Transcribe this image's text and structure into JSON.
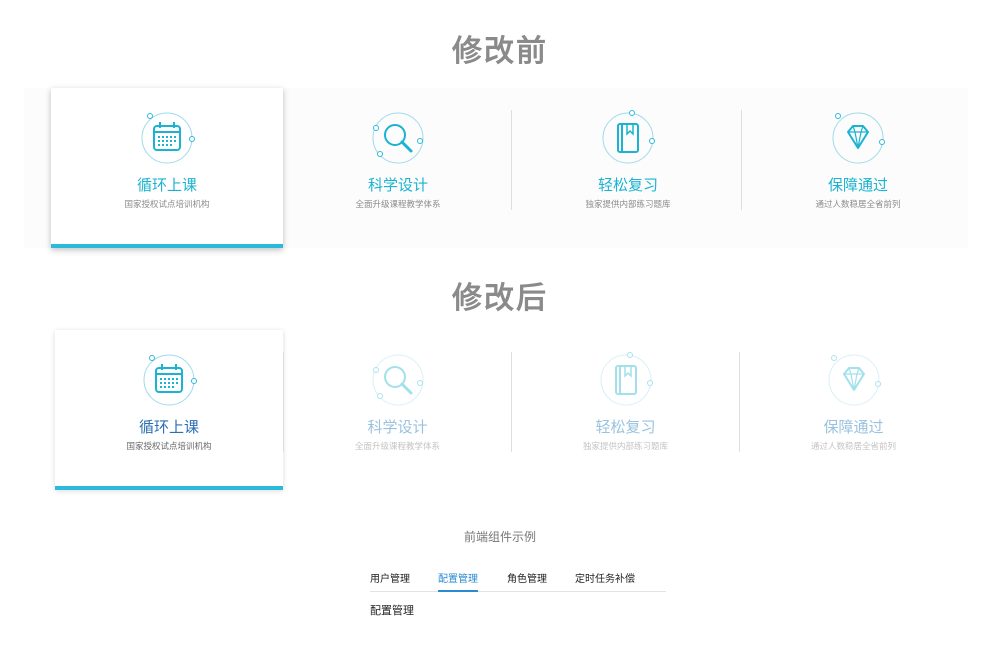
{
  "before": {
    "title": "修改前",
    "cards": [
      {
        "title": "循环上课",
        "sub": "国家授权试点培训机构",
        "icon": "calendar-icon"
      },
      {
        "title": "科学设计",
        "sub": "全面升级课程教学体系",
        "icon": "magnifier-icon"
      },
      {
        "title": "轻松复习",
        "sub": "独家提供内部练习题库",
        "icon": "book-icon"
      },
      {
        "title": "保障通过",
        "sub": "通过人数稳居全省前列",
        "icon": "diamond-icon"
      }
    ]
  },
  "after": {
    "title": "修改后",
    "cards": [
      {
        "title": "循环上课",
        "sub": "国家授权试点培训机构",
        "icon": "calendar-icon"
      },
      {
        "title": "科学设计",
        "sub": "全面升级课程教学体系",
        "icon": "magnifier-icon"
      },
      {
        "title": "轻松复习",
        "sub": "独家提供内部练习题库",
        "icon": "book-icon"
      },
      {
        "title": "保障通过",
        "sub": "通过人数稳居全省前列",
        "icon": "diamond-icon"
      }
    ]
  },
  "demo": {
    "title": "前端组件示例",
    "tabs": [
      "用户管理",
      "配置管理",
      "角色管理",
      "定时任务补偿"
    ],
    "active_tab": "配置管理",
    "content": "配置管理"
  },
  "colors": {
    "accent": "#2bbadc",
    "tab_active": "#2a8ad2",
    "heading": "#8a8a8a"
  }
}
